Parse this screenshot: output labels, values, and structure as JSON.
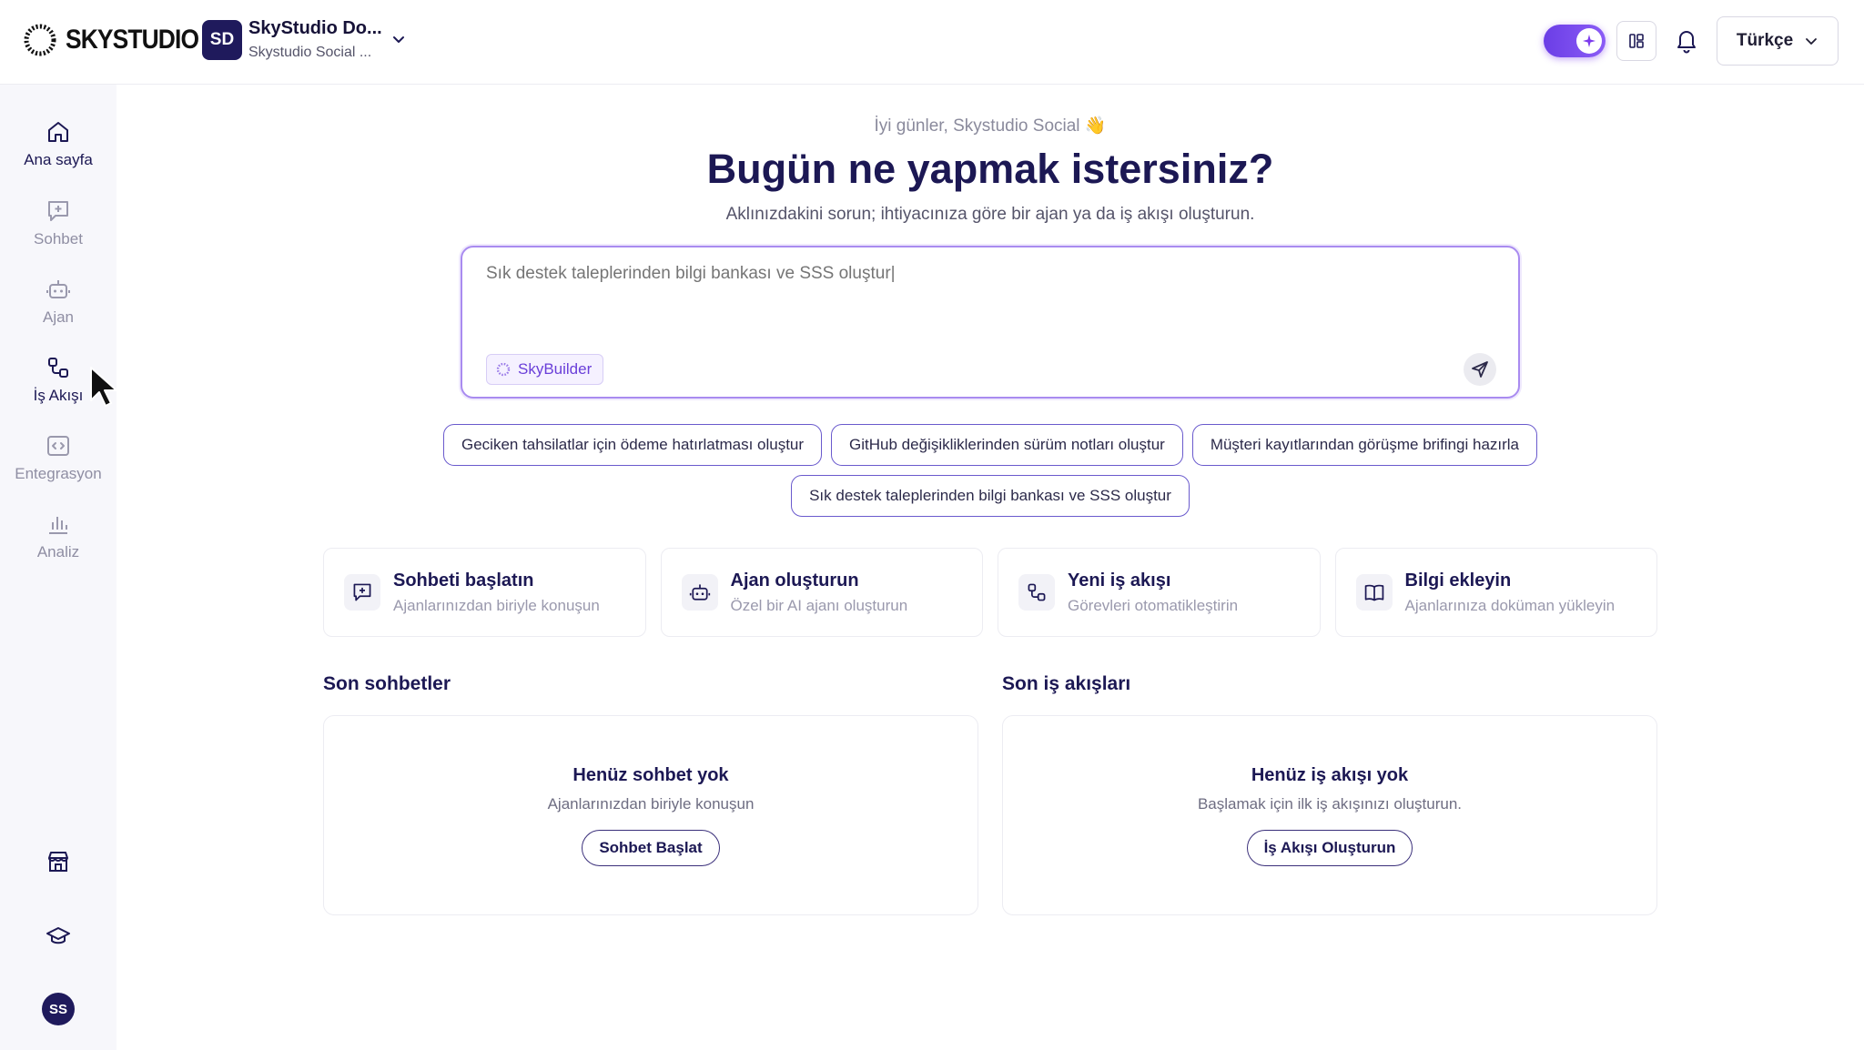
{
  "header": {
    "logo_text": "SKYSTUDIO",
    "workspace": {
      "initials": "SD",
      "name": "SkyStudio Do...",
      "sub": "Skystudio Social ..."
    },
    "language": "Türkçe"
  },
  "sidebar": {
    "items": [
      {
        "label": "Ana sayfa",
        "icon": "home-icon"
      },
      {
        "label": "Sohbet",
        "icon": "chat-plus-icon"
      },
      {
        "label": "Ajan",
        "icon": "bot-icon"
      },
      {
        "label": "İş Akışı",
        "icon": "workflow-icon"
      },
      {
        "label": "Entegrasyon",
        "icon": "code-icon"
      },
      {
        "label": "Analiz",
        "icon": "bar-chart-icon"
      }
    ],
    "user_initials": "SS"
  },
  "main": {
    "greeting": "İyi günler, Skystudio Social 👋",
    "title": "Bugün ne yapmak istersiniz?",
    "subtitle": "Aklınızdakini sorun; ihtiyacınıza göre bir ajan ya da iş akışı oluşturun.",
    "prompt": {
      "placeholder": "Sık destek taleplerinden bilgi bankası ve SSS oluştur|",
      "chip": "SkyBuilder"
    },
    "suggestions": [
      "Geciken tahsilatlar için ödeme hatırlatması oluştur",
      "GitHub değişikliklerinden sürüm notları oluştur",
      "Müşteri kayıtlarından görüşme brifingi hazırla",
      "Sık destek taleplerinden bilgi bankası ve SSS oluştur"
    ],
    "cards": [
      {
        "title": "Sohbeti başlatın",
        "desc": "Ajanlarınızdan biriyle konuşun",
        "icon": "chat-plus-icon"
      },
      {
        "title": "Ajan oluşturun",
        "desc": "Özel bir AI ajanı oluşturun",
        "icon": "bot-icon"
      },
      {
        "title": "Yeni iş akışı",
        "desc": "Görevleri otomatikleştirin",
        "icon": "workflow-icon"
      },
      {
        "title": "Bilgi ekleyin",
        "desc": "Ajanlarınıza doküman yükleyin",
        "icon": "book-icon"
      }
    ],
    "recent_chats": {
      "title": "Son sohbetler",
      "empty_title": "Henüz sohbet yok",
      "empty_desc": "Ajanlarınızdan biriyle konuşun",
      "button": "Sohbet Başlat"
    },
    "recent_workflows": {
      "title": "Son iş akışları",
      "empty_title": "Henüz iş akışı yok",
      "empty_desc": "Başlamak için ilk iş akışınızı oluşturun.",
      "button": "İş Akışı Oluşturun"
    }
  },
  "colors": {
    "primary": "#1c1854",
    "accent": "#7c3aed",
    "sidebar_bg": "#f7f7fb"
  }
}
